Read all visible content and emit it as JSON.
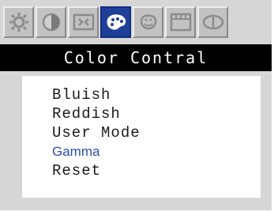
{
  "tabs": [
    {
      "icon": "brightness-icon"
    },
    {
      "icon": "contrast-icon"
    },
    {
      "icon": "position-icon"
    },
    {
      "icon": "color-palette-icon",
      "active": true
    },
    {
      "icon": "osd-settings-icon"
    },
    {
      "icon": "image-setup-icon"
    },
    {
      "icon": "source-input-icon"
    }
  ],
  "header": {
    "title": "Color Contral"
  },
  "menu": {
    "items": [
      "Bluish",
      "Reddish",
      "User Mode",
      "Gamma",
      "Reset"
    ],
    "selected": "Gamma"
  },
  "colors": {
    "title_bg": "#000000",
    "active_tab": "#1f3f99",
    "selected_item": "#2a4fb0"
  }
}
